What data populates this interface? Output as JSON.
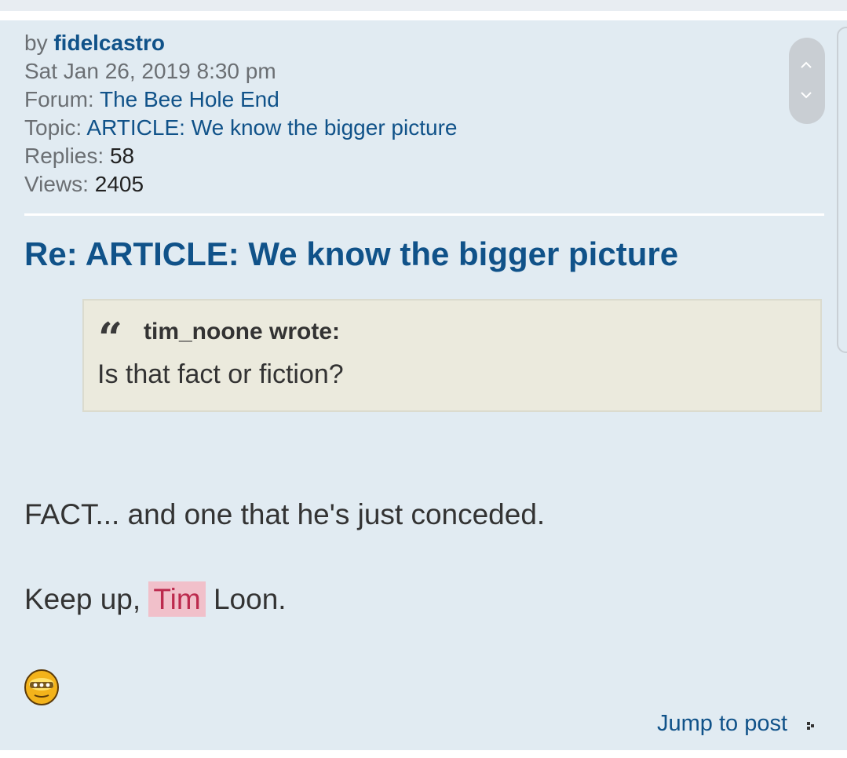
{
  "meta": {
    "by_label": "by",
    "author": "fidelcastro",
    "date": "Sat Jan 26, 2019 8:30 pm",
    "forum_label": "Forum:",
    "forum_name": "The Bee Hole End",
    "topic_label": "Topic:",
    "topic_name": "ARTICLE: We know the bigger picture",
    "replies_label": "Replies:",
    "replies_value": "58",
    "views_label": "Views:",
    "views_value": "2405"
  },
  "post": {
    "title": "Re: ARTICLE: We know the bigger picture",
    "quote": {
      "author": "tim_noone wrote:",
      "text": "Is that fact or fiction?"
    },
    "line1": "FACT... and one that he's just conceded.",
    "line2_before": "Keep up,",
    "line2_mention": "Tim",
    "line2_after": "Loon."
  },
  "footer": {
    "jump_label": "Jump to post"
  },
  "icons": {
    "quote": "quote-mark-icon",
    "smiley": "smiley-icon",
    "jump": "jump-arrow-icon",
    "scroll_up": "chevron-up-icon",
    "scroll_down": "chevron-down-icon"
  },
  "colors": {
    "panel_bg": "#e1ebf2",
    "link": "#105289",
    "quote_bg": "#ebeadd",
    "mention_bg": "#f1c0ca",
    "mention_text": "#bc2a4d"
  }
}
